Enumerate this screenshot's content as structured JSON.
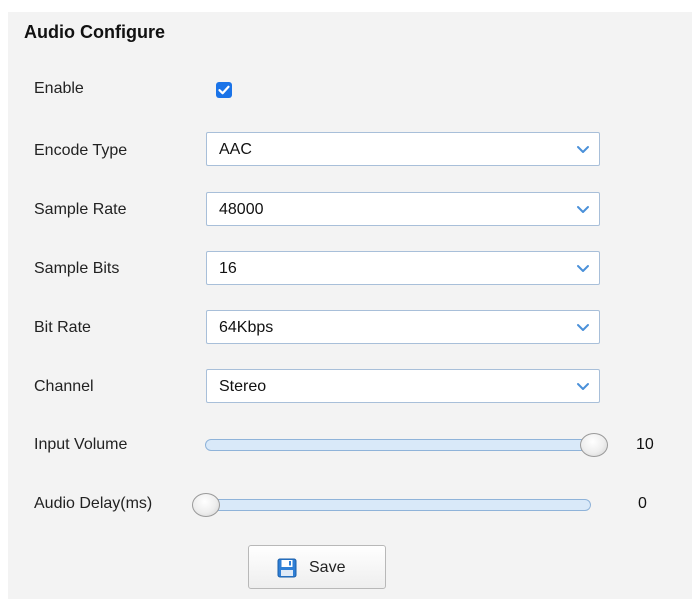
{
  "section": {
    "title": "Audio Configure"
  },
  "enable": {
    "label": "Enable",
    "checked": true
  },
  "fields": {
    "encode_type": {
      "label": "Encode Type",
      "value": "AAC"
    },
    "sample_rate": {
      "label": "Sample Rate",
      "value": "48000"
    },
    "sample_bits": {
      "label": "Sample Bits",
      "value": "16"
    },
    "bit_rate": {
      "label": "Bit Rate",
      "value": "64Kbps"
    },
    "channel": {
      "label": "Channel",
      "value": "Stereo"
    }
  },
  "sliders": {
    "input_volume": {
      "label": "Input Volume",
      "value": "10"
    },
    "audio_delay": {
      "label": "Audio Delay(ms)",
      "value": "0"
    }
  },
  "actions": {
    "save_label": "Save"
  },
  "icons": {
    "checkbox": "checkmark-icon",
    "dropdown": "chevron-down-icon",
    "save": "floppy-disk-icon"
  },
  "colors": {
    "accent": "#1a73e8",
    "panel_bg": "#f3f3f3",
    "field_border": "#a8bfd9",
    "slider_track": "#d9e9f9"
  }
}
